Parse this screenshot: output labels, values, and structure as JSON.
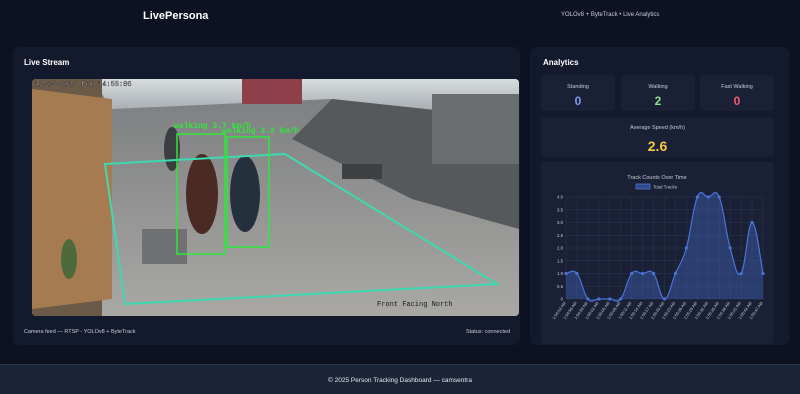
{
  "header": {
    "brand": "LivePersona",
    "tagline": "YOLOv8 + ByteTrack • Live Analytics"
  },
  "stream": {
    "title": "Live Stream",
    "overlay": {
      "timestamp": "12-05-2025 Fri 14:55:06",
      "label_1": "walking 3.7 km/h",
      "label_2": "walking 3.2 km/h",
      "camera_label": "Front Facing North"
    },
    "caption": "Camera feed — RTSP - YOLOv8 + ByteTrack",
    "status": "Status: connected"
  },
  "analytics": {
    "title": "Analytics",
    "standing": {
      "label": "Standing",
      "value": "0"
    },
    "walking": {
      "label": "Walking",
      "value": "2"
    },
    "fast_walking": {
      "label": "Fast Walking",
      "value": "0"
    },
    "avg_speed": {
      "label": "Average Speed (km/h)",
      "value": "2.6"
    },
    "colors": {
      "standing": "#7b9cf0",
      "walking": "#8de28a",
      "fast_walking": "#f25c6c",
      "avg_speed": "#f5c842",
      "series": "#4a73d8"
    }
  },
  "chart_data": {
    "type": "area",
    "title": "Track Counts Over Time",
    "legend": "top",
    "series": [
      {
        "name": "Total Tracks",
        "values": [
          1,
          1,
          0,
          0,
          0,
          0,
          1,
          1,
          1,
          0,
          1,
          2,
          4,
          4,
          4,
          2,
          1,
          3,
          1
        ]
      }
    ],
    "categories": [
      "1:54:53 AM",
      "1:54:56 AM",
      "1:54:59 AM",
      "1:55:02 AM",
      "1:55:05 AM",
      "1:55:08 AM",
      "1:55:11 AM",
      "1:55:14 AM",
      "1:55:17 AM",
      "1:55:20 AM",
      "1:55:23 AM",
      "1:55:26 AM",
      "1:55:29 AM",
      "1:55:32 AM",
      "1:55:35 AM",
      "1:55:38 AM",
      "1:55:41 AM",
      "1:55:44 AM",
      "1:55:47 AM"
    ],
    "ylim": [
      0,
      4
    ],
    "yticks": [
      "0",
      "0.5",
      "1.0",
      "1.5",
      "2.0",
      "2.5",
      "3.0",
      "3.5",
      "4.0"
    ],
    "grid": true
  },
  "footer": {
    "text": "© 2025 Person Tracking Dashboard — camsentra"
  }
}
